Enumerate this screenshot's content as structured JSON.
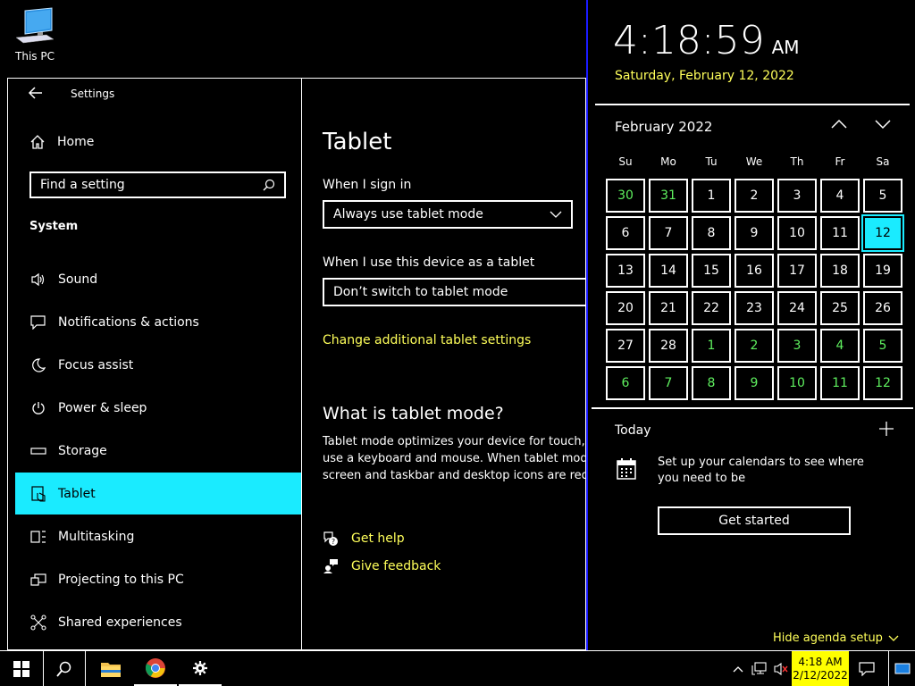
{
  "desktop": {
    "this_pc_label": "This PC"
  },
  "settings": {
    "title": "Settings",
    "home": "Home",
    "search_placeholder": "Find a setting",
    "section": "System",
    "nav": [
      {
        "label": "Sound",
        "icon": "speaker-icon"
      },
      {
        "label": "Notifications & actions",
        "icon": "message-icon"
      },
      {
        "label": "Focus assist",
        "icon": "moon-icon"
      },
      {
        "label": "Power & sleep",
        "icon": "power-icon"
      },
      {
        "label": "Storage",
        "icon": "storage-icon"
      },
      {
        "label": "Tablet",
        "icon": "tablet-icon",
        "active": true
      },
      {
        "label": "Multitasking",
        "icon": "multitasking-icon"
      },
      {
        "label": "Projecting to this PC",
        "icon": "projecting-icon"
      },
      {
        "label": "Shared experiences",
        "icon": "shared-icon"
      }
    ],
    "page_title": "Tablet",
    "sign_in_label": "When I sign in",
    "sign_in_value": "Always use tablet mode",
    "device_label": "When I use this device as a tablet",
    "device_value": "Don’t switch to tablet mode",
    "change_link": "Change additional tablet settings",
    "what_title": "What is tablet mode?",
    "what_lines": [
      "Tablet mode optimizes your device for touch, so",
      "use a keyboard and mouse. When tablet mode i",
      "screen and taskbar and desktop icons are reduc"
    ],
    "get_help": "Get help",
    "give_feedback": "Give feedback"
  },
  "flyout": {
    "time": "4:18:59",
    "ampm": "AM",
    "date": "Saturday, February 12, 2022",
    "month": "February 2022",
    "days_of_week": [
      "Su",
      "Mo",
      "Tu",
      "We",
      "Th",
      "Fr",
      "Sa"
    ],
    "weeks": [
      [
        "30",
        "31",
        "1",
        "2",
        "3",
        "4",
        "5"
      ],
      [
        "6",
        "7",
        "8",
        "9",
        "10",
        "11",
        "12"
      ],
      [
        "13",
        "14",
        "15",
        "16",
        "17",
        "18",
        "19"
      ],
      [
        "20",
        "21",
        "22",
        "23",
        "24",
        "25",
        "26"
      ],
      [
        "27",
        "28",
        "1",
        "2",
        "3",
        "4",
        "5"
      ],
      [
        "6",
        "7",
        "8",
        "9",
        "10",
        "11",
        "12"
      ]
    ],
    "other_month": [
      [
        true,
        true,
        false,
        false,
        false,
        false,
        false
      ],
      [
        false,
        false,
        false,
        false,
        false,
        false,
        false
      ],
      [
        false,
        false,
        false,
        false,
        false,
        false,
        false
      ],
      [
        false,
        false,
        false,
        false,
        false,
        false,
        false
      ],
      [
        false,
        false,
        true,
        true,
        true,
        true,
        true
      ],
      [
        true,
        true,
        true,
        true,
        true,
        true,
        true
      ]
    ],
    "today_cell": {
      "week": 1,
      "day": 6
    },
    "today_label": "Today",
    "agenda_text_1": "Set up your calendars to see where",
    "agenda_text_2": "you need to be",
    "get_started": "Get started",
    "hide_agenda": "Hide agenda setup"
  },
  "taskbar": {
    "clock_time": "4:18 AM",
    "clock_date": "2/12/2022"
  },
  "colors": {
    "accent": "#1aebff",
    "link": "#ffff5a",
    "other_month": "#5ff05f",
    "clock_bg": "#ffff00"
  }
}
